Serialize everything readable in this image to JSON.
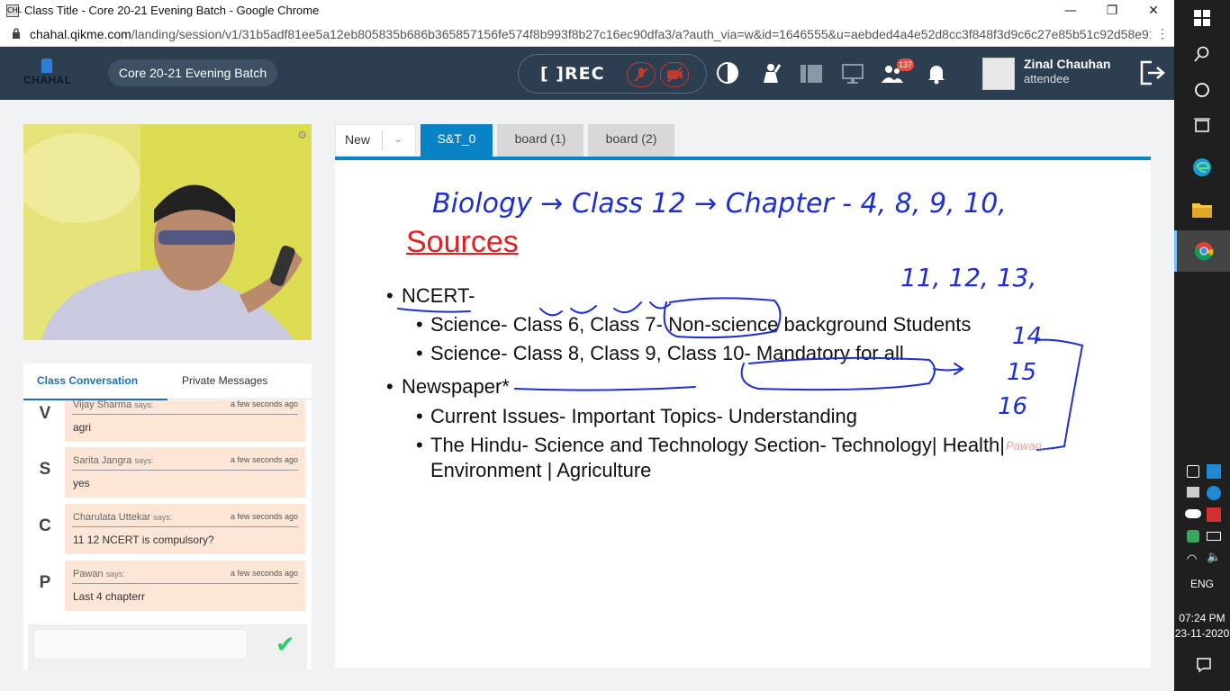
{
  "browser": {
    "window_title": "Class Title - Core 20-21 Evening Batch - Google Chrome",
    "favicon_text": "CHL",
    "url_host": "chahal.qikme.com",
    "url_path": "/landing/session/v1/31b5adf81ee5a12eb805835b686b365857156fe574f8b993f8b27c16ec90dfa3/a?auth_via=w&id=1646555&u=aebded4a4e52d8cc3f848f3d9c6c27e85b51c92d58e91..."
  },
  "header": {
    "logo_text": "CHAHAL",
    "class_name": "Core 20-21 Evening Batch",
    "rec_label": "REC",
    "participants_count": "137",
    "user": {
      "name": "Zinal Chauhan",
      "role": "attendee"
    }
  },
  "chat": {
    "tabs": [
      "Class Conversation",
      "Private Messages"
    ],
    "says": "says:",
    "messages": [
      {
        "initial": "V",
        "name": "Vijay Sharma",
        "time": "a few seconds ago",
        "text": "agri"
      },
      {
        "initial": "S",
        "name": "Sarita Jangra",
        "time": "a few seconds ago",
        "text": "yes"
      },
      {
        "initial": "C",
        "name": "Charulata Uttekar",
        "time": "a few seconds ago",
        "text": "11 12 NCERT is compulsory?"
      },
      {
        "initial": "P",
        "name": "Pawan",
        "time": "a few seconds ago",
        "text": "Last 4 chapterr"
      }
    ]
  },
  "board": {
    "new_label": "New",
    "tabs": [
      {
        "label": "S&T_0",
        "active": true
      },
      {
        "label": "board (1)",
        "active": false
      },
      {
        "label": "board (2)",
        "active": false
      }
    ],
    "slide": {
      "title": "Sources",
      "bullets": [
        {
          "text": "NCERT-",
          "sub": [
            "Science- Class 6, Class 7- Non-science background Students",
            "Science- Class 8, Class 9, Class 10- Mandatory for all"
          ]
        },
        {
          "text": "Newspaper*",
          "sub": [
            "Current Issues- Important Topics- Understanding",
            "The Hindu- Science and Technology Section- Technology| Health|",
            "Environment | Agriculture"
          ]
        }
      ],
      "handwriting": {
        "line1": "Biology → Class 12 → Chapter - 4, 8, 9, 10,",
        "line2": "11, 12, 13,",
        "line3": "14",
        "line4": "15",
        "line5": "16"
      },
      "watermark": "Pawan..."
    }
  },
  "taskbar": {
    "language": "ENG",
    "time": "07:24 PM",
    "date": "23-11-2020"
  }
}
